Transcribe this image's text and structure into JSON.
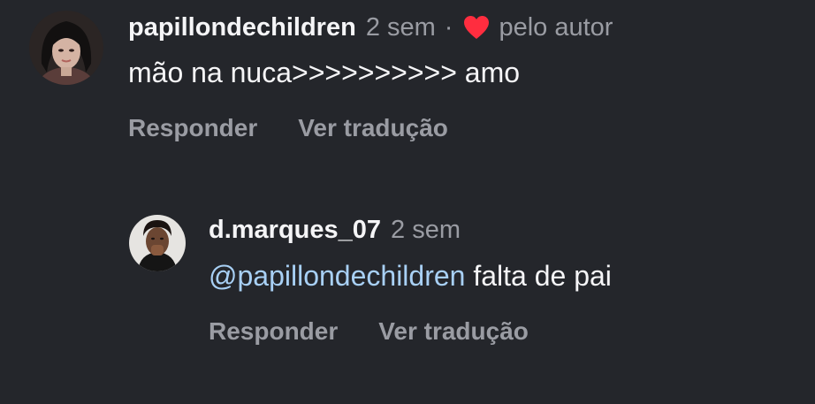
{
  "colors": {
    "background": "#24262b",
    "primary_text": "#f5f5f7",
    "secondary_text": "#9a9ca3",
    "mention": "#a8d0f5",
    "heart": "#ff2d3f"
  },
  "comment": {
    "username": "papillondechildren",
    "time": "2 sem",
    "separator": "·",
    "liked_icon": "heart-icon",
    "liked_label": "pelo autor",
    "text": "mão na nuca>>>>>>>>>> amo",
    "reply_label": "Responder",
    "translate_label": "Ver tradução"
  },
  "reply": {
    "username": "d.marques_07",
    "time": "2 sem",
    "mention": "@papillondechildren",
    "text": " falta de pai",
    "reply_label": "Responder",
    "translate_label": "Ver tradução"
  }
}
